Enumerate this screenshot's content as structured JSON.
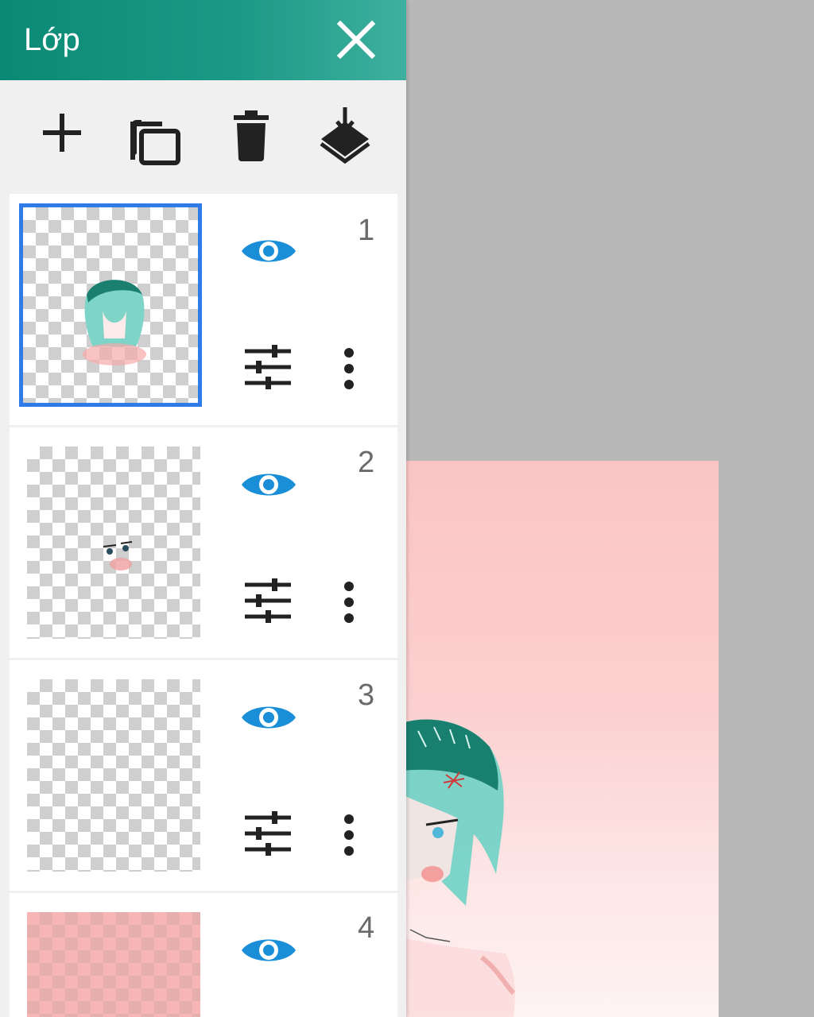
{
  "panel": {
    "title": "Lớp",
    "close_icon": "close-icon"
  },
  "toolbar": {
    "buttons": [
      {
        "name": "add-layer-button",
        "icon": "plus-icon"
      },
      {
        "name": "duplicate-layer-button",
        "icon": "copy-icon"
      },
      {
        "name": "delete-layer-button",
        "icon": "trash-icon"
      },
      {
        "name": "merge-down-button",
        "icon": "merge-down-icon"
      }
    ]
  },
  "layers": [
    {
      "number": "1",
      "visible": true,
      "selected": true
    },
    {
      "number": "2",
      "visible": true,
      "selected": false
    },
    {
      "number": "3",
      "visible": true,
      "selected": false
    },
    {
      "number": "4",
      "visible": true,
      "selected": false
    }
  ],
  "colors": {
    "header": "#0a8a75",
    "accent_blue": "#1a8fd8",
    "selection_border": "#2f7ce8",
    "artboard_background": "#fbc4c4"
  }
}
